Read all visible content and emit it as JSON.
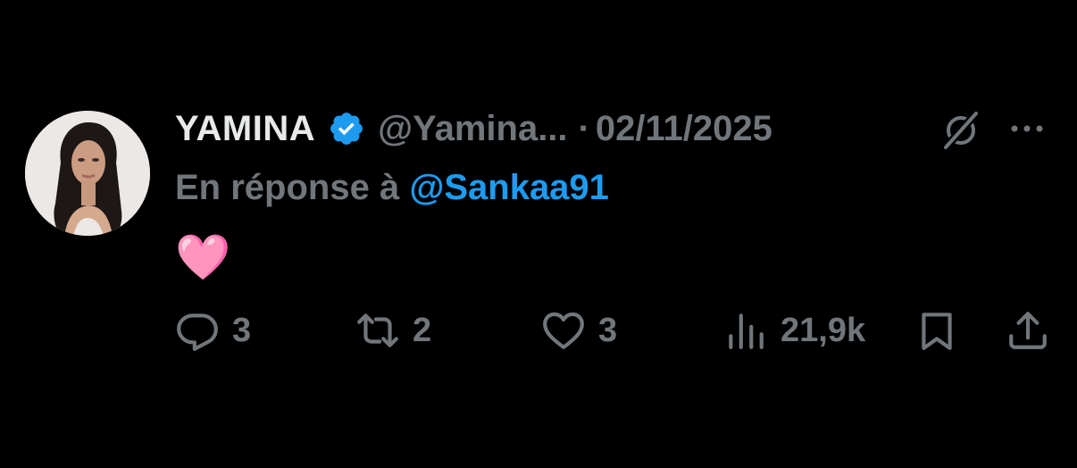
{
  "tweet": {
    "author": {
      "display_name": "YAMINA",
      "handle": "@Yamina...",
      "verified": true,
      "avatar_icon": "profile-photo"
    },
    "separator": "·",
    "date": "02/11/2025",
    "reply_prefix": "En réponse à",
    "reply_mention": "@Sankaa91",
    "content": "🩷",
    "metrics": {
      "replies": "3",
      "retweets": "2",
      "likes": "3",
      "views": "21,9k"
    }
  },
  "icons": {
    "verified": "verified-badge-icon",
    "grok": "grok-icon",
    "more": "more-options-icon",
    "reply": "reply-icon",
    "retweet": "retweet-icon",
    "like": "heart-icon",
    "views": "views-icon",
    "bookmark": "bookmark-icon",
    "share": "share-icon"
  },
  "colors": {
    "background": "#000000",
    "text_primary": "#e7e9ea",
    "text_secondary": "#71767b",
    "accent": "#1d9bf0"
  }
}
